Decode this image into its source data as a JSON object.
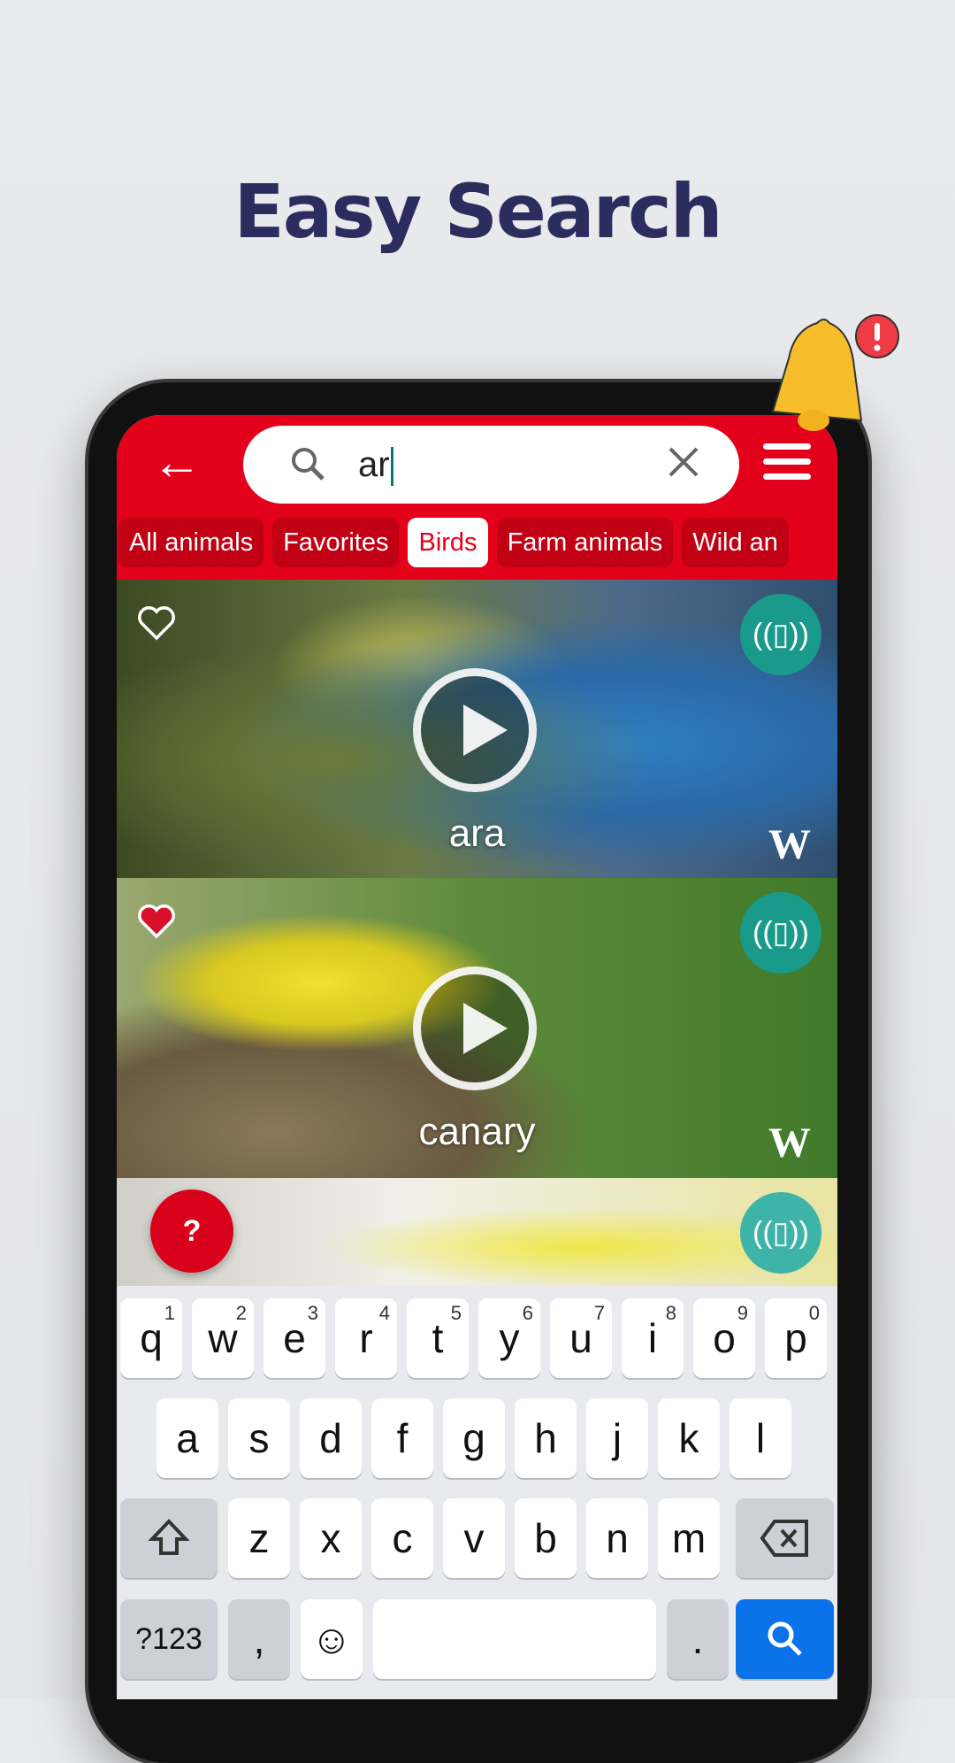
{
  "headline": "Easy Search",
  "search": {
    "value": "ar"
  },
  "tabs": [
    "All animals",
    "Favorites",
    "Birds",
    "Farm animals",
    "Wild an"
  ],
  "active_tab": "Birds",
  "cards": [
    {
      "name": "ara",
      "favorite": false,
      "wiki": "W"
    },
    {
      "name": "canary",
      "favorite": true,
      "wiki": "W"
    },
    {
      "name": "",
      "favorite": false
    }
  ],
  "help_label": "?",
  "colors": {
    "header": "#e3001b",
    "vibrate": "#1a9a8a",
    "headline": "#2b2d5e",
    "search_key": "#0b72ea"
  },
  "keyboard": {
    "row1": [
      {
        "k": "q",
        "n": "1"
      },
      {
        "k": "w",
        "n": "2"
      },
      {
        "k": "e",
        "n": "3"
      },
      {
        "k": "r",
        "n": "4"
      },
      {
        "k": "t",
        "n": "5"
      },
      {
        "k": "y",
        "n": "6"
      },
      {
        "k": "u",
        "n": "7"
      },
      {
        "k": "i",
        "n": "8"
      },
      {
        "k": "o",
        "n": "9"
      },
      {
        "k": "p",
        "n": "0"
      }
    ],
    "row2": [
      "a",
      "s",
      "d",
      "f",
      "g",
      "h",
      "j",
      "k",
      "l"
    ],
    "row3": [
      "z",
      "x",
      "c",
      "v",
      "b",
      "n",
      "m"
    ],
    "symbols": "?123",
    "comma": ",",
    "period": "."
  }
}
